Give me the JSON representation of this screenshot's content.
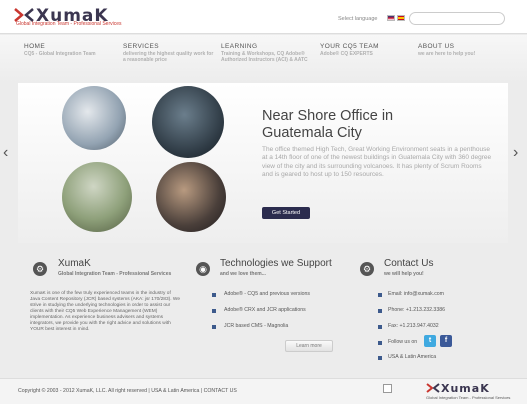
{
  "header": {
    "logo_word": "XumaK",
    "logo_tagline": "Global Integration Team - Professional Services",
    "language_label": "Select language",
    "search_placeholder": ""
  },
  "nav": [
    {
      "title": "HOME",
      "sub": "CQ5 - Global Integration Team"
    },
    {
      "title": "SERVICES",
      "sub": "delivering the highest quality work for a reasonable price"
    },
    {
      "title": "LEARNING",
      "sub": "Training & Workshops, CQ Adobe® Authorized Instructors (ACI) & AATC"
    },
    {
      "title": "YOUR CQ5 TEAM",
      "sub": "Adobe® CQ EXPERTS"
    },
    {
      "title": "ABOUT US",
      "sub": "we are here to help you!"
    }
  ],
  "slider": {
    "title": "Near Shore Office in Guatemala City",
    "body": "The office themed High Tech, Great Working Environment seats in a penthouse at a 14th floor of one of the newest buildings in Guatemala City with 360 degree view of the city and its surrounding volcanoes. It has plenty of Scrum Rooms and is geared to host up to 150 resources.",
    "button": "Get Started",
    "prev": "‹",
    "next": "›"
  },
  "col1": {
    "title": "XumaK",
    "sub": "Global Integration Team - Professional Services",
    "text": "XumaK is one of the few truly experienced teams in the industry of Java Content Repository (JCR) based systems (AKA: jsr 170/283). We strive in studying the underlying technologies in order to assist our clients with their CQ5 Web Experience Management (WEM) implementation. As experience business advisers and systems integrators, we provide you with the right advice and solutions with YOUR best interest in mind."
  },
  "col2": {
    "title": "Technologies we Support",
    "sub": "and we love them...",
    "items": [
      "Adobe® - CQ5 and previous versions",
      "Adobe® CRX and JCR applications",
      "JCR based CMS - Magnolia"
    ],
    "button": "Learn more"
  },
  "col3": {
    "title": "Contact Us",
    "sub": "we will help you!",
    "email": "Email: info@xumak.com",
    "phone": "Phone: +1.213.232.3386",
    "fax": "Fax: +1.213.947.4032",
    "follow": "Follow us on",
    "region": "USA & Latin America"
  },
  "footer": {
    "copyright": "Copyright © 2003 - 2012 XumaK, LLC. All right reserved | USA & Latin America | CONTACT US",
    "logo_word": "XumaK",
    "logo_tagline": "Global Integration Team - Professional Services"
  }
}
